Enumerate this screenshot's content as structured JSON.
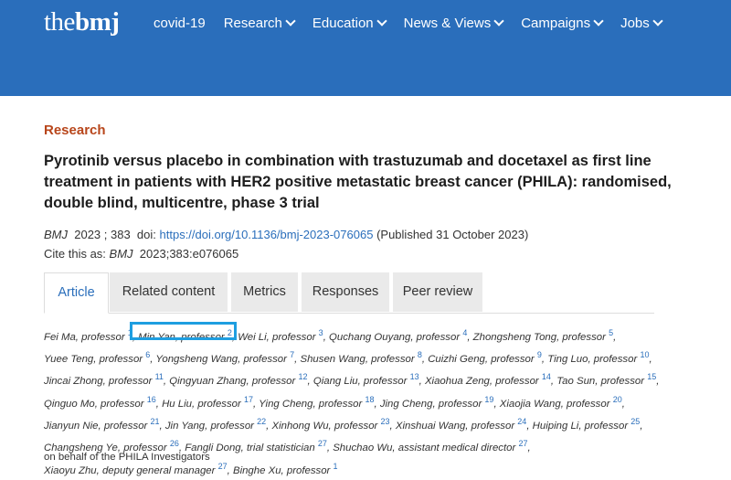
{
  "header": {
    "logo": {
      "light": "the",
      "bold": "bmj"
    },
    "nav": [
      {
        "label": "covid-19",
        "dropdown": false
      },
      {
        "label": "Research",
        "dropdown": true
      },
      {
        "label": "Education",
        "dropdown": true
      },
      {
        "label": "News & Views",
        "dropdown": true
      },
      {
        "label": "Campaigns",
        "dropdown": true
      },
      {
        "label": "Jobs",
        "dropdown": true
      }
    ]
  },
  "article": {
    "section": "Research",
    "title": "Pyrotinib versus placebo in combination with trastuzumab and docetaxel as first line treatment in patients with HER2 positive metastatic breast cancer (PHILA): randomised, double blind, multicentre, phase 3 trial",
    "journal": "BMJ",
    "year_vol": "2023 ; 383",
    "doi_label": "doi:",
    "doi": "https://doi.org/10.1136/bmj-2023-076065",
    "published": "(Published 31 October 2023)",
    "cite_prefix": "Cite this as:",
    "cite_journal": "BMJ",
    "cite_ref": "2023;383:e076065"
  },
  "tabs": [
    {
      "label": "Article",
      "active": true
    },
    {
      "label": "Related content",
      "active": false
    },
    {
      "label": "Metrics",
      "active": false
    },
    {
      "label": "Responses",
      "active": false
    },
    {
      "label": "Peer review",
      "active": false
    }
  ],
  "authors": [
    {
      "name": "Fei Ma, professor",
      "aff": "1"
    },
    {
      "name": "Min Yan, professor",
      "aff": "2"
    },
    {
      "name": "Wei Li, professor",
      "aff": "3"
    },
    {
      "name": "Quchang Ouyang, professor",
      "aff": "4"
    },
    {
      "name": "Zhongsheng Tong, professor",
      "aff": "5"
    },
    {
      "name": "Yuee Teng, professor",
      "aff": "6"
    },
    {
      "name": "Yongsheng Wang, professor",
      "aff": "7"
    },
    {
      "name": "Shusen Wang, professor",
      "aff": "8"
    },
    {
      "name": "Cuizhi Geng, professor",
      "aff": "9"
    },
    {
      "name": "Ting Luo, professor",
      "aff": "10"
    },
    {
      "name": "Jincai Zhong, professor",
      "aff": "11"
    },
    {
      "name": "Qingyuan Zhang, professor",
      "aff": "12"
    },
    {
      "name": "Qiang Liu, professor",
      "aff": "13"
    },
    {
      "name": "Xiaohua Zeng, professor",
      "aff": "14"
    },
    {
      "name": "Tao Sun, professor",
      "aff": "15"
    },
    {
      "name": "Qinguo Mo, professor",
      "aff": "16"
    },
    {
      "name": "Hu Liu, professor",
      "aff": "17"
    },
    {
      "name": "Ying Cheng, professor",
      "aff": "18"
    },
    {
      "name": "Jing Cheng, professor",
      "aff": "19"
    },
    {
      "name": "Xiaojia Wang, professor",
      "aff": "20"
    },
    {
      "name": "Jianyun Nie, professor",
      "aff": "21"
    },
    {
      "name": "Jin Yang, professor",
      "aff": "22"
    },
    {
      "name": "Xinhong Wu, professor",
      "aff": "23"
    },
    {
      "name": "Xinshuai Wang, professor",
      "aff": "24"
    },
    {
      "name": "Huiping Li, professor",
      "aff": "25"
    },
    {
      "name": "Changsheng Ye, professor",
      "aff": "26"
    },
    {
      "name": "Fangli Dong, trial statistician",
      "aff": "27"
    },
    {
      "name": "Shuchao Wu, assistant medical director",
      "aff": "27"
    },
    {
      "name": "Xiaoyu Zhu, deputy general manager",
      "aff": "27"
    },
    {
      "name": "Binghe Xu, professor",
      "aff": "1"
    }
  ],
  "behalf": "on behalf of the PHILA Investigators",
  "colors": {
    "header": "#2a6ebb",
    "section": "#b8461b",
    "link": "#2a6ebb",
    "highlight": "#1e9ee0"
  }
}
